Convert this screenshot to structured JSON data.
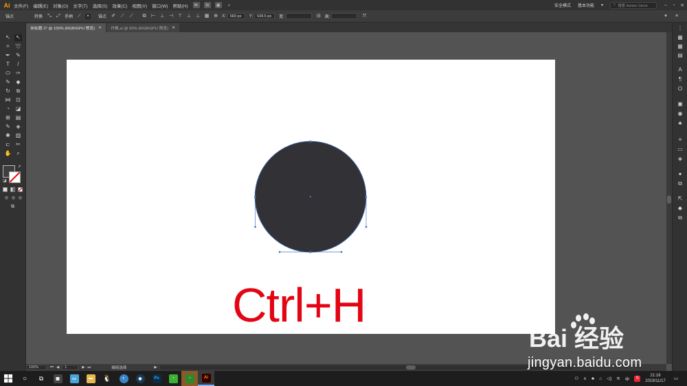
{
  "app": {
    "logo": "Ai"
  },
  "menubar": {
    "items": [
      "文件(F)",
      "编辑(E)",
      "对象(O)",
      "文字(T)",
      "选择(S)",
      "效果(C)",
      "视图(V)",
      "窗口(W)",
      "帮助(H)"
    ],
    "icons": [
      "Br",
      "St"
    ],
    "right": {
      "mode": "安全模式",
      "workspace": "基本功能",
      "search_placeholder": "搜索 Adobe Stock"
    }
  },
  "controlbar": {
    "anchor_label": "锚点",
    "convert_label": "转换",
    "handles_label": "手柄",
    "anchors_label": "锚点",
    "x_label": "X:",
    "x_value": "683 px",
    "y_label": "Y:",
    "y_value": "539.5 px",
    "w_label": "宽:",
    "h_label": "高:"
  },
  "tabs": [
    {
      "label": "未标题-1* @ 100% (RGB/GPU 预览)",
      "active": true
    },
    {
      "label": "丹枫.ai @ 50% (RGB/GPU 预览)",
      "active": false
    }
  ],
  "overlay_text": "Ctrl+H",
  "statusbar": {
    "zoom": "100%",
    "page": "1",
    "mode": "编组选择"
  },
  "taskbar": {
    "apps": [
      "calculator",
      "explorer",
      "folder",
      "qq",
      "browser",
      "camera",
      "Ps",
      "wechat",
      "wechat-2",
      "Ai"
    ],
    "tray": {
      "ime": "中",
      "clock_time": "21:16",
      "clock_date": "2019/11/17"
    }
  },
  "watermark": {
    "brand": "Bai 经验",
    "url": "jingyan.baidu.com"
  },
  "colors": {
    "accent_red": "#e30513",
    "circle_fill": "#323236",
    "selection_blue": "#4a78c8",
    "ai_orange": "#ff9a00"
  }
}
